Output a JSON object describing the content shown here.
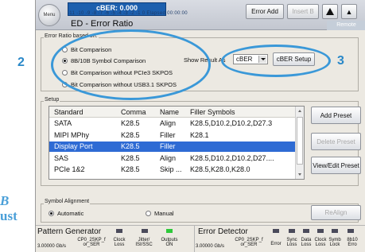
{
  "document": {
    "letter": "B",
    "word": "ust"
  },
  "titlebar": {
    "menu_label": "Menu",
    "error_banner": "cBER: 0.000",
    "scale_text": "-11 -10 -9 -8 -7 -6 -5 -4 -3 -2 -1 0 Elapsed 00:00:00",
    "title": "ED - Error Ratio",
    "error_add": "Error Add",
    "insert_b": "Insert B",
    "remote": "Remote"
  },
  "error_ratio": {
    "group_label": "Error Ratio based on:",
    "options": [
      {
        "label": "Bit Comparison",
        "selected": false
      },
      {
        "label": "8B/10B Symbol Comparison",
        "selected": true
      },
      {
        "label": "Bit Comparison without PCIe3 SKPOS",
        "selected": false
      },
      {
        "label": "Bit Comparison without USB3.1 SKPOS",
        "selected": false
      }
    ],
    "show_result_label": "Show Result As",
    "show_result_value": "cBER",
    "cber_setup": "cBER Setup"
  },
  "setup": {
    "group_label": "Setup",
    "columns": [
      "Standard",
      "Comma",
      "Name",
      "Filler Symbols"
    ],
    "rows": [
      {
        "standard": "SATA",
        "comma": "K28.5",
        "name": "Align",
        "filler": "K28.5,D10.2,D10.2,D27.3",
        "selected": false
      },
      {
        "standard": "MIPI MPhy",
        "comma": "K28.5",
        "name": "Filler",
        "filler": "K28.1",
        "selected": false
      },
      {
        "standard": "Display Port",
        "comma": "K28.5",
        "name": "Filler",
        "filler": "",
        "selected": true
      },
      {
        "standard": "SAS",
        "comma": "K28.5",
        "name": "Align",
        "filler": "K28.5,D10.2,D10.2,D27....",
        "selected": false
      },
      {
        "standard": "PCIe 1&2",
        "comma": "K28.5",
        "name": "Skip ...",
        "filler": "K28.5,K28.0,K28.0",
        "selected": false
      }
    ],
    "add_preset": "Add Preset",
    "delete_preset": "Delete Preset",
    "view_edit_preset": "View/Edit Preset"
  },
  "symbol_alignment": {
    "group_label": "Symbol Alignment",
    "automatic": "Automatic",
    "manual": "Manual",
    "selected": "Automatic",
    "realign": "ReAlign"
  },
  "status_bar": {
    "pattern_generator": {
      "title": "Pattern Generator",
      "rate": "3.00000 Gb/s",
      "pattern": "CP0_2SKP_f or_SER",
      "clock_loss": "Clock Loss",
      "jitter": "Jitter/ ISI/SSC",
      "outputs": "Outputs ON"
    },
    "error_detector": {
      "title": "Error Detector",
      "rate": "3.00000 Gb/s",
      "pattern": "CP0_2SKP_f or_SER",
      "error": "Error",
      "sync_loss": "Sync Loss",
      "data_loss": "Data Loss",
      "clock_loss": "Clock Loss",
      "symb_lock": "Symb Lock",
      "err_8b10b": "8b10 Erro"
    }
  },
  "callouts": {
    "two": "2",
    "three": "3"
  },
  "colors": {
    "accent": "#3a98d8",
    "selection": "#2e6bd4",
    "banner": "#1c5fae",
    "led_green": "#2dc93a"
  }
}
